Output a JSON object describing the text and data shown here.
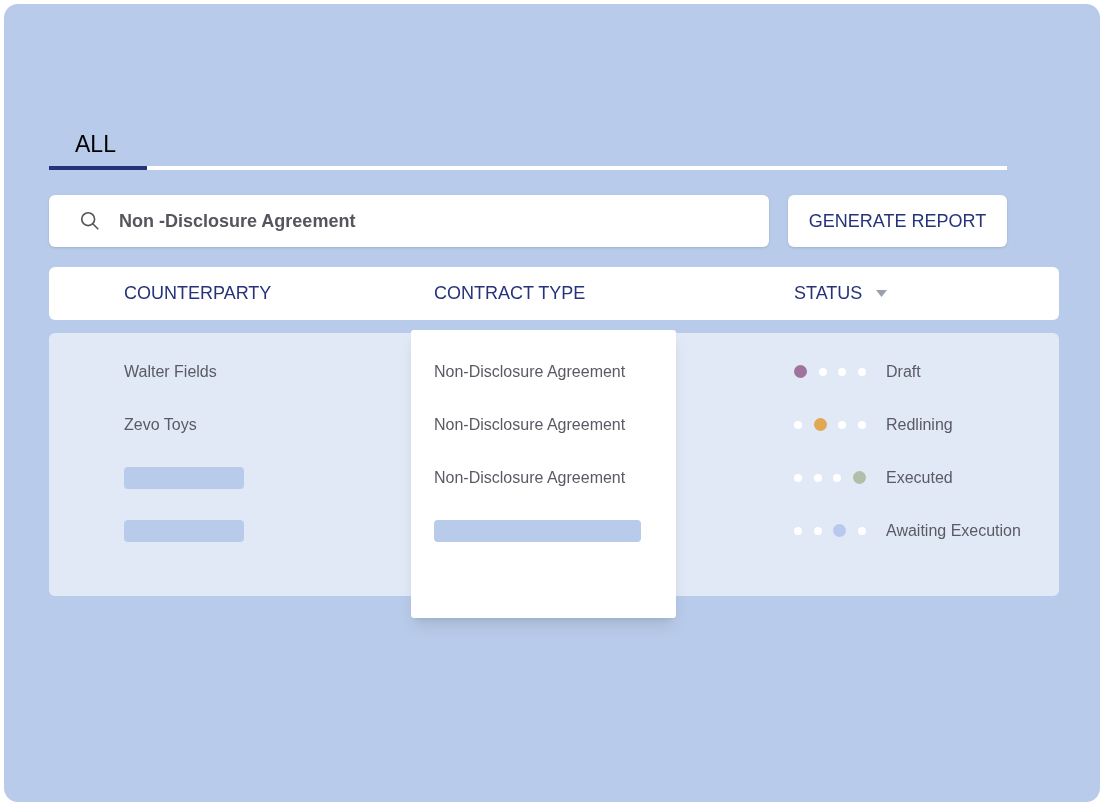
{
  "tabs": [
    {
      "label": "ALL",
      "selected": true
    }
  ],
  "search": {
    "value": "Non -Disclosure Agreement"
  },
  "report_button": "GENERATE REPORT",
  "columns": [
    {
      "label": "COUNTERPARTY",
      "kind": "plain"
    },
    {
      "label": "CONTRACT TYPE",
      "kind": "plain"
    },
    {
      "label": "STATUS",
      "kind": "sortable"
    }
  ],
  "rows": [
    {
      "counterparty": {
        "kind": "text",
        "text": "Walter Fields"
      },
      "contract_type": {
        "kind": "text",
        "text": "Non-Disclosure Agreement"
      },
      "status": {
        "label": "Draft",
        "color": "#a0739f",
        "steps": [
          {
            "active": true
          },
          {
            "active": false
          },
          {
            "active": false
          },
          {
            "active": false
          }
        ]
      }
    },
    {
      "counterparty": {
        "kind": "text",
        "text": "Zevo Toys"
      },
      "contract_type": {
        "kind": "text",
        "text": "Non-Disclosure Agreement"
      },
      "status": {
        "label": "Redlining",
        "color": "#e0a852",
        "steps": [
          {
            "active": false
          },
          {
            "active": true
          },
          {
            "active": false
          },
          {
            "active": false
          }
        ]
      }
    },
    {
      "counterparty": {
        "kind": "skeleton"
      },
      "contract_type": {
        "kind": "text",
        "text": "Non-Disclosure Agreement"
      },
      "status": {
        "label": "Executed",
        "color": "#b1bfaa",
        "steps": [
          {
            "active": false
          },
          {
            "active": false
          },
          {
            "active": false
          },
          {
            "active": true
          }
        ]
      }
    },
    {
      "counterparty": {
        "kind": "skeleton"
      },
      "contract_type": {
        "kind": "skeleton"
      },
      "status": {
        "label": "Awaiting Execution",
        "color": "#b9c8ee",
        "steps": [
          {
            "active": false
          },
          {
            "active": false
          },
          {
            "active": true
          },
          {
            "active": false
          }
        ]
      }
    }
  ]
}
